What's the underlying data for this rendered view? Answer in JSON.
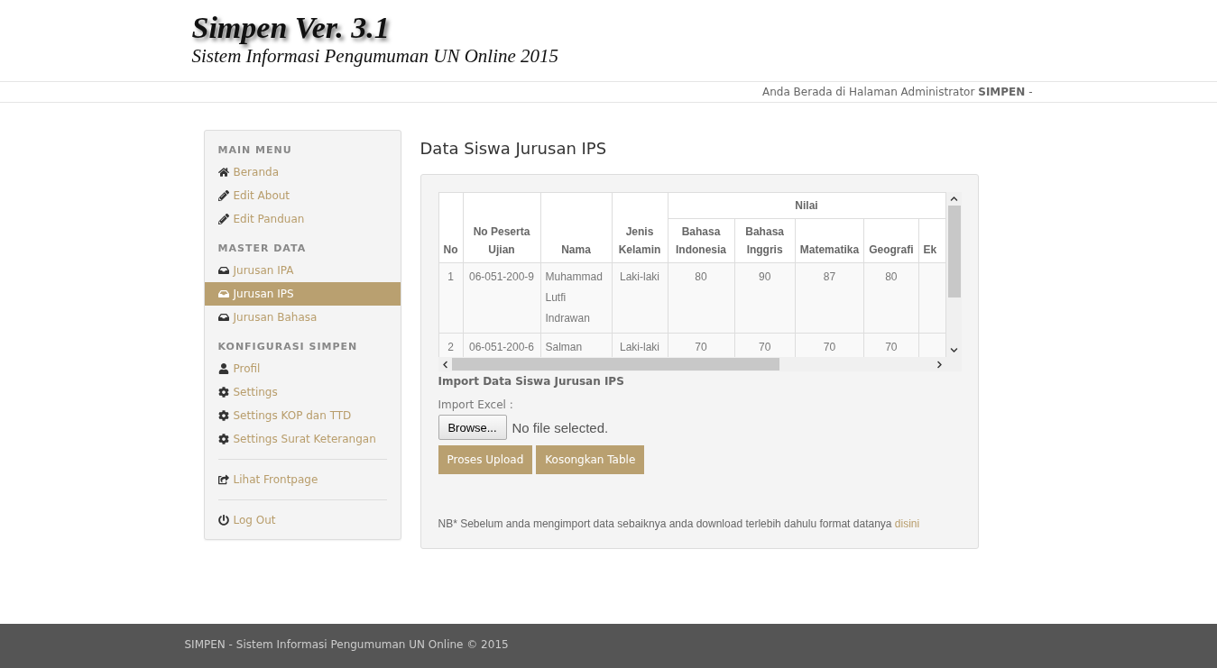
{
  "logo": {
    "title": "Simpen Ver. 3.1",
    "subtitle": "Sistem Informasi Pengumuman UN Online 2015"
  },
  "breadcrumb": {
    "text": "Anda Berada di Halaman Administrator",
    "strong": "SIMPEN",
    "suffix": "-"
  },
  "sidebar": {
    "sections": [
      {
        "heading": "MAIN MENU",
        "items": [
          {
            "kind": "home",
            "label": "Beranda",
            "selected": false
          },
          {
            "kind": "pencil",
            "label": "Edit About",
            "selected": false
          },
          {
            "kind": "pencil",
            "label": "Edit Panduan",
            "selected": false
          }
        ]
      },
      {
        "heading": "MASTER DATA",
        "items": [
          {
            "kind": "inbox",
            "label": "Jurusan IPA",
            "selected": false
          },
          {
            "kind": "inbox",
            "label": "Jurusan IPS",
            "selected": true
          },
          {
            "kind": "inbox",
            "label": "Jurusan Bahasa",
            "selected": false
          }
        ]
      },
      {
        "heading": "KONFIGURASI SIMPEN",
        "items": [
          {
            "kind": "user",
            "label": "Profil",
            "selected": false
          },
          {
            "kind": "cog",
            "label": "Settings",
            "selected": false
          },
          {
            "kind": "cog",
            "label": "Settings KOP dan TTD",
            "selected": false
          },
          {
            "kind": "cog",
            "label": "Settings Surat Keterangan",
            "selected": false
          }
        ]
      },
      {
        "items": [
          {
            "kind": "share",
            "label": "Lihat Frontpage",
            "selected": false
          }
        ]
      },
      {
        "items": [
          {
            "kind": "power",
            "label": "Log Out",
            "selected": false
          }
        ]
      }
    ]
  },
  "main": {
    "title": "Data Siswa Jurusan IPS",
    "table": {
      "group_header": "Nilai",
      "columns": [
        "No",
        "No Peserta Ujian",
        "Nama",
        "Jenis Kelamin"
      ],
      "sub_columns": [
        "Bahasa Indonesia",
        "Bahasa Inggris",
        "Matematika",
        "Geografi",
        "Ek"
      ],
      "rows": [
        [
          "1",
          "06-051-200-9",
          "Muhammad Lutfi Indrawan",
          "Laki-laki",
          "80",
          "90",
          "87",
          "80",
          ""
        ],
        [
          "2",
          "06-051-200-6",
          "Salman",
          "Laki-laki",
          "70",
          "70",
          "70",
          "70",
          ""
        ]
      ]
    },
    "import_title": "Import Data Siswa Jurusan IPS",
    "import_label": "Import Excel :",
    "browse_button": "Browse...",
    "file_status": "No file selected.",
    "buttons": [
      "Proses Upload",
      "Kosongkan Table"
    ],
    "note": "NB* Sebelum anda mengimport data sebaiknya anda download terlebih dahulu format datanya",
    "note_link": "disini"
  },
  "footer": "SIMPEN - Sistem Informasi Pengumuman UN Online © 2015"
}
